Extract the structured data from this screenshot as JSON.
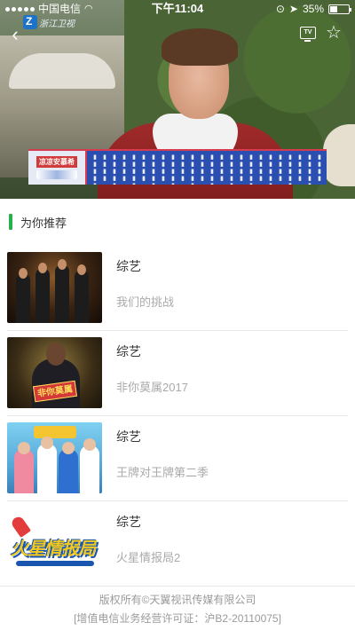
{
  "status_bar": {
    "carrier": "中国电信",
    "time": "下午11:04",
    "battery": "35%",
    "battery_level": 0.35
  },
  "player": {
    "channel_name": "浙江卫视",
    "sponsor": "凉凉安慕希",
    "tv_label": "TV"
  },
  "section": {
    "title": "为你推荐"
  },
  "recommendations": [
    {
      "category": "综艺",
      "name": "我们的挑战"
    },
    {
      "category": "综艺",
      "name": "非你莫属2017",
      "thumb_logo": "非你莫属"
    },
    {
      "category": "综艺",
      "name": "王牌对王牌第二季"
    },
    {
      "category": "综艺",
      "name": "火星情报局2",
      "thumb_logo": "火星情报局"
    }
  ],
  "footer": {
    "copyright": "版权所有©天翼视讯传媒有限公司",
    "license": "[增值电信业务经营许可证：沪B2-20110075]"
  },
  "colors": {
    "accent_green": "#27b14a",
    "banner_blue": "#2b4fb0",
    "muted_text": "#aaaaaa"
  }
}
